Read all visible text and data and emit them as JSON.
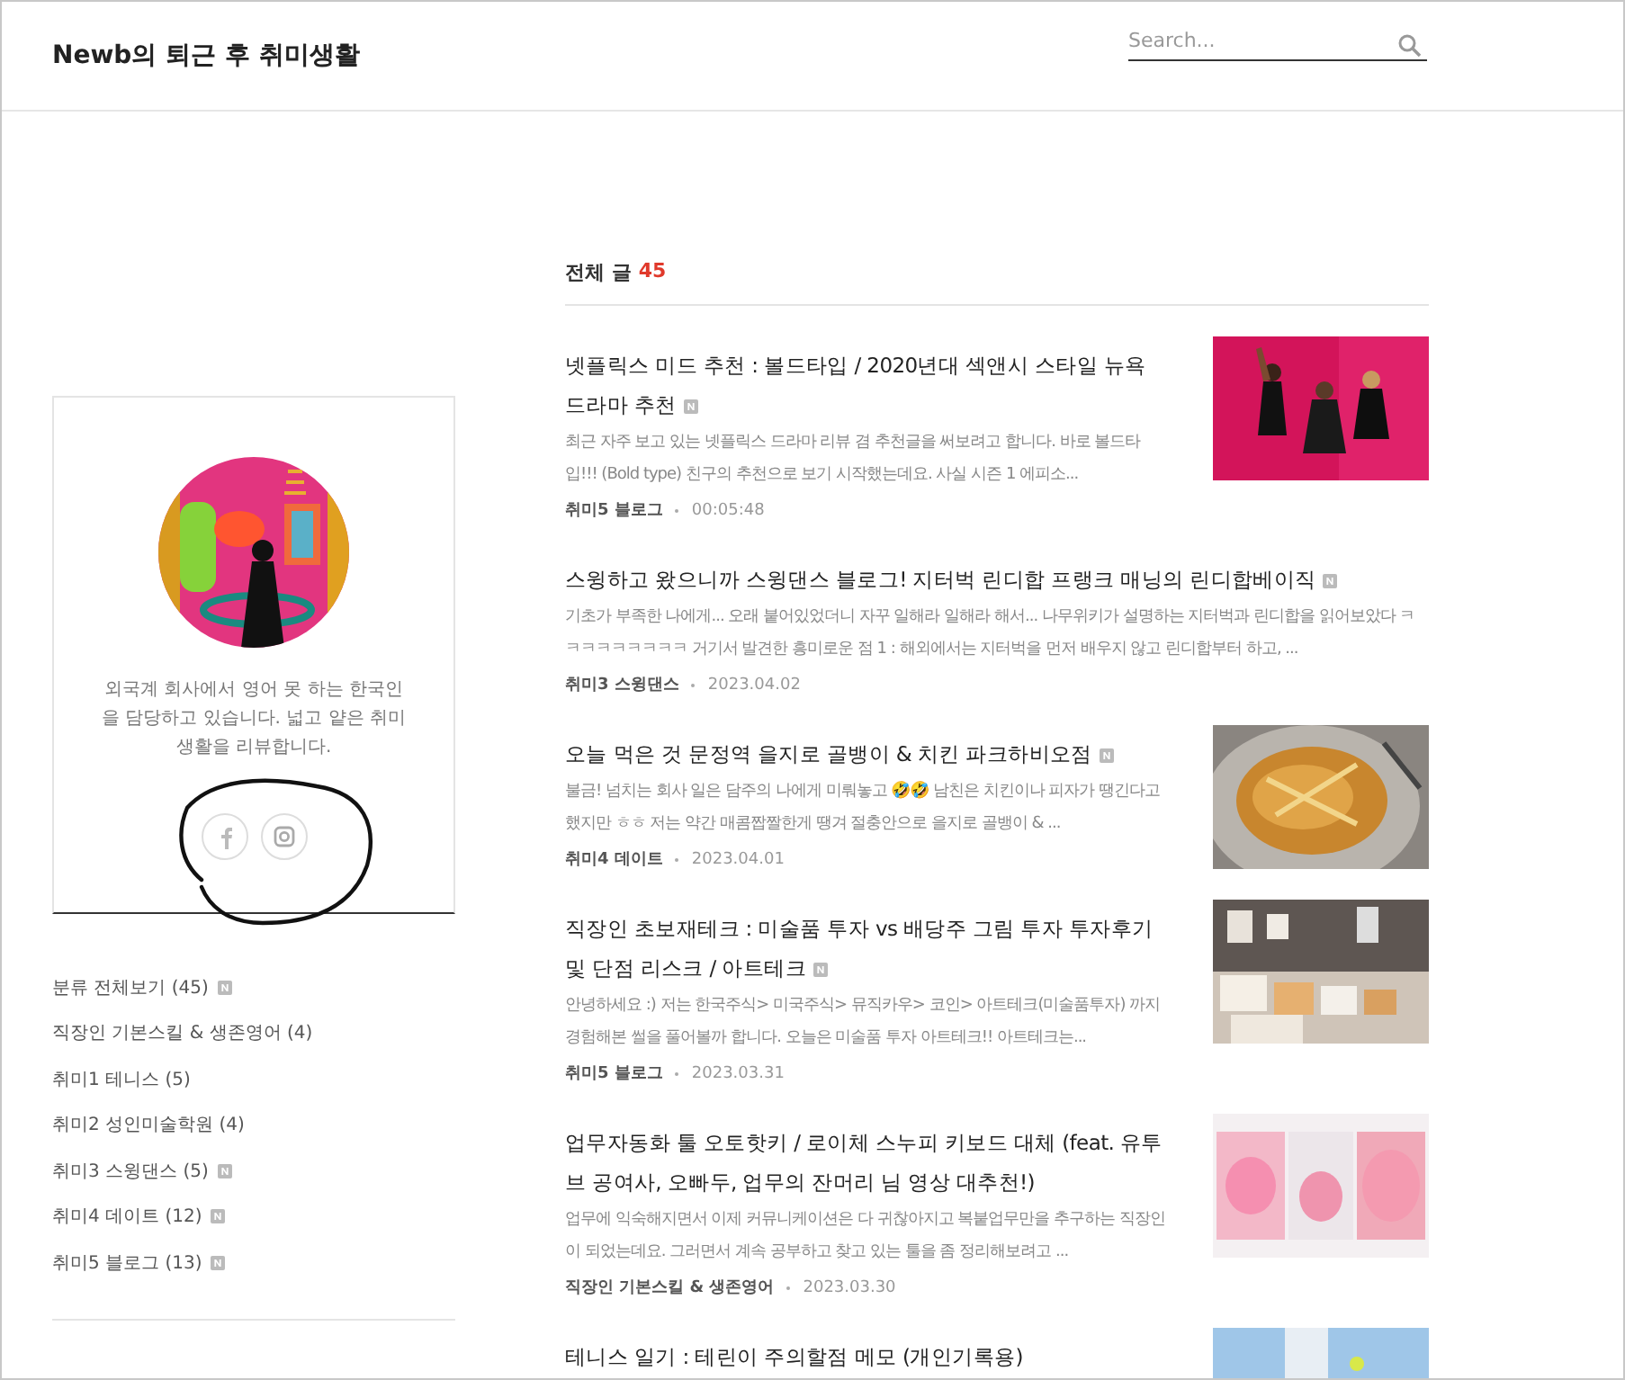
{
  "header": {
    "blog_title": "Newb의 퇴근 후 취미생활",
    "search": {
      "placeholder": "Search..."
    }
  },
  "profile": {
    "description": "외국계 회사에서 영어 못 하는 한국인을 담당하고 있습니다. 넓고 얕은 취미생활을 리뷰합니다.",
    "social_links": [
      {
        "kind": "facebook"
      },
      {
        "kind": "instagram"
      }
    ],
    "circled": true
  },
  "categories": [
    {
      "label": "분류 전체보기 (45)",
      "new": true
    },
    {
      "label": "직장인 기본스킬 & 생존영어 (4)",
      "new": false
    },
    {
      "label": "취미1 테니스 (5)",
      "new": false
    },
    {
      "label": "취미2 성인미술학원 (4)",
      "new": false
    },
    {
      "label": "취미3 스윙댄스 (5)",
      "new": true
    },
    {
      "label": "취미4 데이트 (12)",
      "new": true
    },
    {
      "label": "취미5 블로그 (13)",
      "new": true
    }
  ],
  "post_list": {
    "heading": "전체 글",
    "count": "45",
    "posts": [
      {
        "title": "넷플릭스 미드 추천 : 볼드타입 / 2020년대 섹앤시 스타일 뉴욕 드라마 추천",
        "new": true,
        "excerpt": "최근 자주 보고 있는 넷플릭스 드라마 리뷰 겸 추천글을 써보려고 합니다. 바로 볼드타입!!! (Bold type) 친구의 추천으로 보기 시작했는데요. 사실 시즌 1 에피소...",
        "category": "취미5 블로그",
        "date": "00:05:48"
      },
      {
        "title": "스윙하고 왔으니까 스윙댄스 블로그! 지터벅 린디합 프랭크 매닝의 린디합베이직",
        "new": true,
        "excerpt": "기초가 부족한 나에게... 오래 붙어있었더니 자꾸 일해라 일해라 해서... 나무위키가 설명하는 지터벅과 린디합을 읽어보았다 ㅋㅋㅋㅋㅋㅋㅋㅋㅋ 거기서 발견한 흥미로운 점 1 : 해외에서는 지터벅을 먼저 배우지 않고 린디합부터 하고, ...",
        "category": "취미3 스윙댄스",
        "date": "2023.04.02"
      },
      {
        "title": "오늘 먹은 것 문정역 을지로 골뱅이 & 치킨 파크하비오점",
        "new": true,
        "excerpt": "불금! 넘치는 회사 일은 담주의 나에게 미뤄놓고 🤣🤣 남친은 치킨이나 피자가 땡긴다고 했지만 ㅎㅎ 저는 약간 매콤짭짤한게 땡겨 절충안으로 을지로 골뱅이 & ...",
        "category": "취미4 데이트",
        "date": "2023.04.01"
      },
      {
        "title": "직장인 초보재테크 : 미술품 투자 vs 배당주 그림 투자 투자후기 및 단점 리스크 / 아트테크",
        "new": true,
        "excerpt": "안녕하세요 :) 저는 한국주식> 미국주식> 뮤직카우> 코인> 아트테크(미술품투자) 까지 경험해본 썰을 풀어볼까 합니다. 오늘은 미술품 투자 아트테크!! 아트테크는...",
        "category": "취미5 블로그",
        "date": "2023.03.31"
      },
      {
        "title": "업무자동화 툴 오토핫키 / 로이체 스누피 키보드 대체 (feat. 유투브 공여사, 오빠두, 업무의 잔머리 님 영상 대추천!)",
        "new": false,
        "excerpt": "업무에 익숙해지면서 이제 커뮤니케이션은 다 귀찮아지고 복붙업무만을 추구하는 직장인이 되었는데요. 그러면서 계속 공부하고 찾고 있는 툴을 좀 정리해보려고 ...",
        "category": "직장인 기본스킬 & 생존영어",
        "date": "2023.03.30"
      },
      {
        "title": "테니스 일기 : 테린이 주의할점 메모 (개인기록용)",
        "new": false
      }
    ]
  }
}
